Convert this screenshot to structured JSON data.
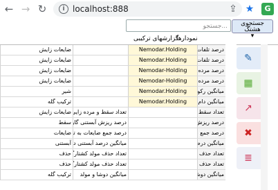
{
  "browser": {
    "back_icon": "←",
    "forward_icon": "→",
    "reload_icon": "↻",
    "url": "localhost:888",
    "share_icon": "⇪",
    "star_icon": "★",
    "ext_icon": "G"
  },
  "toolbar": {
    "search_placeholder": "جستجو...",
    "search_button_line1": "جستجوی هشتگ",
    "search_button_line2": "▾"
  },
  "menu": {
    "items": [
      "نمودارها",
      "گزارشهای ترکیبی"
    ]
  },
  "rows": [
    {
      "c1": "ضایعات زایش",
      "c2": "",
      "c3": "Nemodar.Holding",
      "c4": "درصد تلفات زایی تا"
    },
    {
      "c1": "ضایعات زایش",
      "c2": "",
      "c3": "Nemodar.Holding",
      "c4": "درصد تلفات زایی تا"
    },
    {
      "c1": "ضایعات زایش",
      "c2": "",
      "c3": "Nemodar-Holding",
      "c4": "درصد مرده زایی تا"
    },
    {
      "c1": "ضایعات زایش",
      "c2": "",
      "c3": "Nemodar-Holding",
      "c4": "درصد مرده زایی تا"
    },
    {
      "c1": "شیر",
      "c2": "",
      "c3": "Nemodar.Holding",
      "c4": "میانگین رکورد دام م"
    },
    {
      "c1": "ترکیب گله",
      "c2": "",
      "c3": "Nemodar.Holding",
      "c4": "میانگین دام مولد"
    },
    {
      "c1": "ضایعات زایش",
      "c2": "تعداد سقط و مرده زایی",
      "c3": "",
      "c4": "تعداد سقط و مرده زا"
    },
    {
      "c1": "سقط",
      "c2": "درصد ریزش آبستنی گاو",
      "c3": "",
      "c4": "درصد ریزش آبستنی"
    },
    {
      "c1": "ضایعات",
      "c2": "درصد جمع ضایعات به تفکیک ماه",
      "c3": "",
      "c4": "درصد جمع ضایعات"
    },
    {
      "c1": "آبستنی",
      "c2": "میانگین درصد آبستنی دوشا و مولد ماهیانه",
      "c3": "",
      "c4": "میانگین درصد آبستنی"
    },
    {
      "c1": "حذف",
      "c2": "تعداد حذف مولد کشتارگاهی به تفکیک",
      "c3": "",
      "c4": "تعداد حذف مولد کشت"
    },
    {
      "c1": "حذف",
      "c2": "تعداد حذف مولد کشتارگاهی ماهیانه",
      "c3": "",
      "c4": "تعداد حذف مولد کشت"
    },
    {
      "c1": "ترکیب گله",
      "c2": "میانگین دوشا و مولد",
      "c3": "",
      "c4": "میانگین دوشا و مولد"
    }
  ],
  "sidebar": [
    {
      "name": "edit",
      "icon": "✎",
      "bg": "#e3ecf8",
      "color": "#2266aa"
    },
    {
      "name": "table",
      "icon": "▦",
      "bg": "#e8f3e3",
      "color": "#55aa33"
    },
    {
      "name": "chart",
      "icon": "↗",
      "bg": "#f6e4ea",
      "color": "#cc3355"
    },
    {
      "name": "delete",
      "icon": "✖",
      "bg": "#fae0e0",
      "color": "#cc2222"
    },
    {
      "name": "layers",
      "icon": "≣",
      "bg": "#eef0f7",
      "color": "#cc3355"
    }
  ]
}
